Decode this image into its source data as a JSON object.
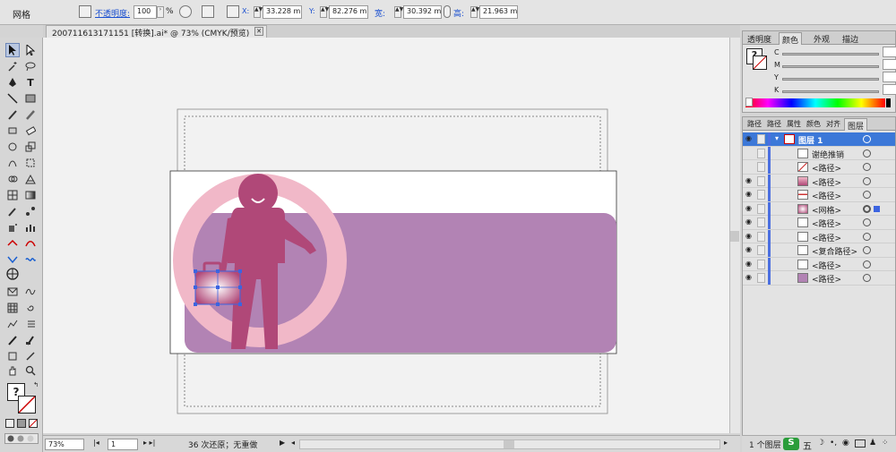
{
  "control_bar": {
    "mode": "网格",
    "opacity_label": "不透明度:",
    "opacity_value": "100",
    "opacity_unit": "%",
    "x_label": "X:",
    "x_value": "33.228 mm",
    "y_label": "Y:",
    "y_value": "82.276 mm",
    "w_label": "宽:",
    "w_value": "30.392 mm",
    "h_label": "高:",
    "h_value": "21.963 mm"
  },
  "document": {
    "tab_title": "200711613171151 [转换].ai* @ 73% (CMYK/预览)",
    "close_glyph": "✕"
  },
  "status_bar": {
    "zoom": "73%",
    "page": "1",
    "history": "36 次还原；无重做"
  },
  "color_panel": {
    "tabs": [
      "透明度",
      "颜色",
      "外观",
      "描边"
    ],
    "active_tab": "颜色",
    "channels": [
      "C",
      "M",
      "Y",
      "K"
    ],
    "question_glyph": "?"
  },
  "layers_panel": {
    "tabs": [
      "路径",
      "路径",
      "属性",
      "颜色",
      "对齐",
      "图层"
    ],
    "active_tab": "图层",
    "rows": [
      {
        "name": "图层 1",
        "eye": true,
        "thumb": "layer",
        "top": true
      },
      {
        "name": "谢绝推销",
        "eye": false,
        "thumb": "text"
      },
      {
        "name": "<路径>",
        "eye": false,
        "thumb": "line"
      },
      {
        "name": "<路径>",
        "eye": true,
        "thumb": "pink"
      },
      {
        "name": "<路径>",
        "eye": true,
        "thumb": "redline"
      },
      {
        "name": "<网格>",
        "eye": true,
        "thumb": "mesh"
      },
      {
        "name": "<路径>",
        "eye": true,
        "thumb": "blank"
      },
      {
        "name": "<路径>",
        "eye": true,
        "thumb": "blank"
      },
      {
        "name": "<复合路径>",
        "eye": true,
        "thumb": "blank"
      },
      {
        "name": "<路径>",
        "eye": true,
        "thumb": "blank"
      },
      {
        "name": "<路径>",
        "eye": true,
        "thumb": "purple"
      }
    ],
    "footer": "1 个图层"
  },
  "colors": {
    "accent": "#1a6fd0",
    "purple_band": "#b283b4",
    "ring": "#f1b8c8",
    "figure": "#b04878"
  }
}
